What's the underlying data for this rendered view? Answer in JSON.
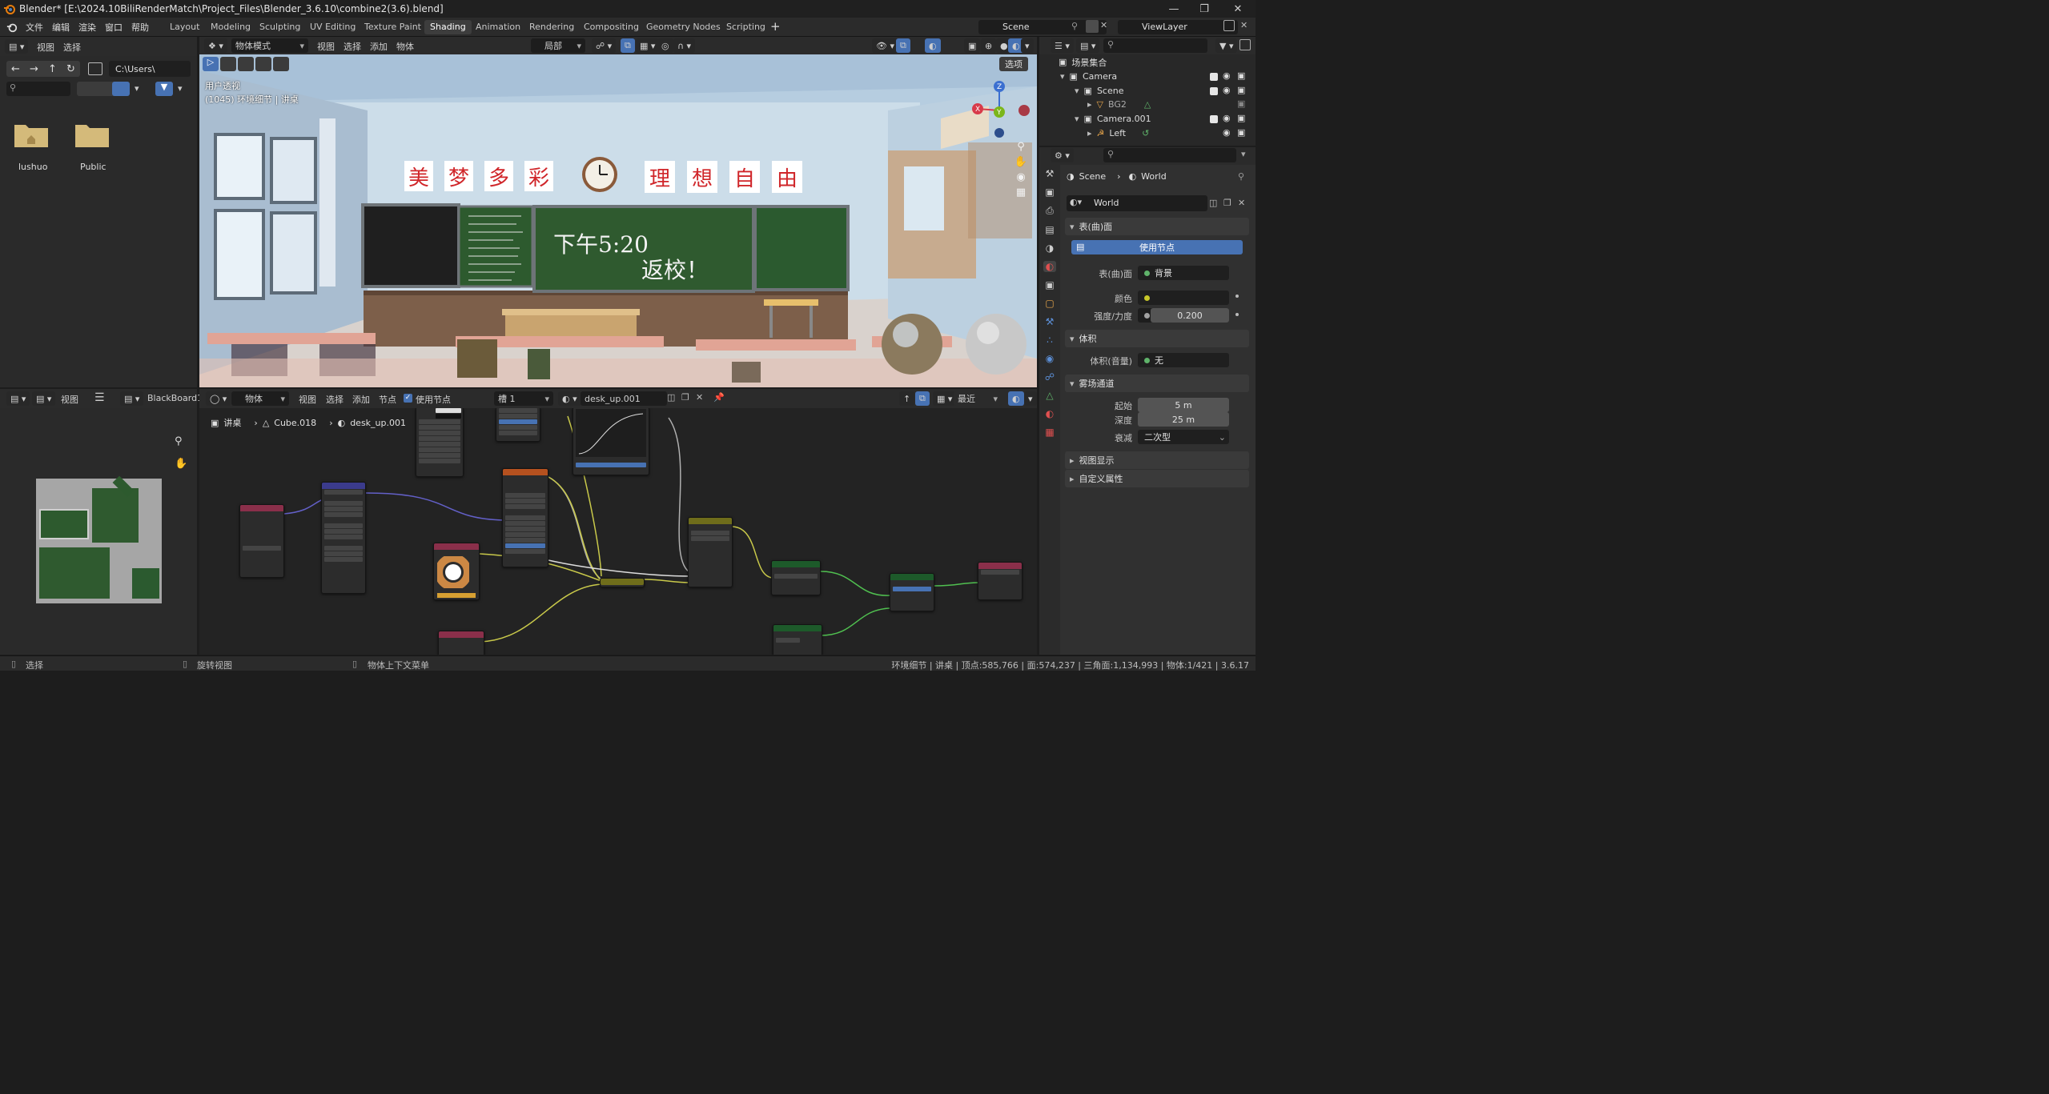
{
  "window": {
    "title": "Blender* [E:\\2024.10BiliRenderMatch\\Project_Files\\Blender_3.6.10\\combine2(3.6).blend]"
  },
  "menus": [
    "文件",
    "编辑",
    "渲染",
    "窗口",
    "帮助"
  ],
  "workspaces": [
    "Layout",
    "Modeling",
    "Sculpting",
    "UV Editing",
    "Texture Paint",
    "Shading",
    "Animation",
    "Rendering",
    "Compositing",
    "Geometry Nodes",
    "Scripting"
  ],
  "active_workspace": "Shading",
  "scene_selector": "Scene",
  "viewlayer_selector": "ViewLayer",
  "file_browser": {
    "menus": [
      "视图",
      "选择"
    ],
    "path": "C:\\Users\\",
    "folders": [
      "lushuo",
      "Public"
    ]
  },
  "viewport": {
    "mode": "物体模式",
    "menus": [
      "视图",
      "选择",
      "添加",
      "物体"
    ],
    "transform": "局部",
    "options_label": "选项",
    "overlay_line1": "用户透视",
    "overlay_line2": "(1045) 环境细节 | 讲桌",
    "banner_left": [
      "美",
      "梦",
      "多",
      "彩"
    ],
    "banner_right": [
      "理",
      "想",
      "自",
      "由"
    ],
    "board_line1": "下午5:20",
    "board_line2": "返校！"
  },
  "image_editor": {
    "menu": "视图",
    "image_name": "BlackBoard1"
  },
  "node_editor": {
    "object_mode": "物体",
    "menus": [
      "视图",
      "选择",
      "添加",
      "节点"
    ],
    "use_nodes_label": "使用节点",
    "slot": "槽 1",
    "material": "desk_up.001",
    "recent": "最近",
    "breadcrumb": [
      "讲桌",
      "Cube.018",
      "desk_up.001"
    ]
  },
  "outliner": {
    "root": "场景集合",
    "rows": [
      {
        "label": "Camera",
        "indent": 1
      },
      {
        "label": "Scene",
        "indent": 2
      },
      {
        "label": "BG2",
        "indent": 3
      },
      {
        "label": "Camera.001",
        "indent": 2
      },
      {
        "label": "Left",
        "indent": 3
      }
    ]
  },
  "properties": {
    "breadcrumb_scene": "Scene",
    "breadcrumb_world": "World",
    "world_name": "World",
    "surface_section": "表(曲)面",
    "use_nodes_button": "使用节点",
    "surface_label": "表(曲)面",
    "surface_value": "背景",
    "color_label": "颜色",
    "strength_label": "强度/力度",
    "strength_value": "0.200",
    "volume_section": "体积",
    "volume_label": "体积(音量)",
    "volume_value": "无",
    "mist_section": "雾场通道",
    "start_label": "起始",
    "start_value": "5 m",
    "depth_label": "深度",
    "depth_value": "25 m",
    "falloff_label": "衰减",
    "falloff_value": "二次型",
    "viewport_display": "视图显示",
    "custom_props": "自定义属性"
  },
  "statusbar": {
    "left1": "选择",
    "left2": "旋转视图",
    "left3": "物体上下文菜单",
    "right": "环境细节 | 讲桌 | 顶点:585,766 | 面:574,237 | 三角面:1,134,993 | 物体:1/421 | 3.6.17"
  },
  "colors": {
    "accent_blue": "#4772b3",
    "banner_red": "#d0262a",
    "chalkboard": "#2f5a2f",
    "wall": "#c9d9e6"
  }
}
